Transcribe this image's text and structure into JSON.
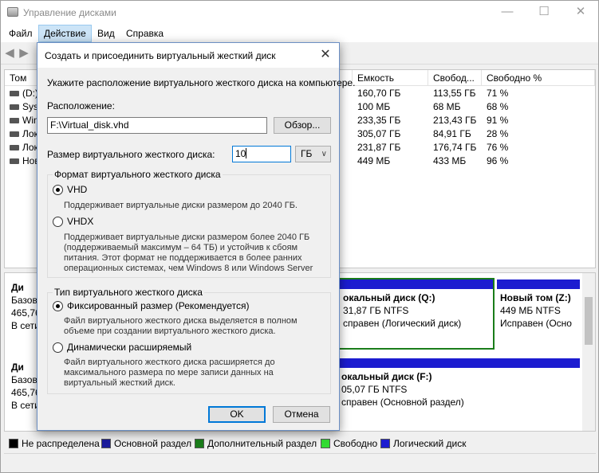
{
  "window": {
    "title": "Управление дисками",
    "controls": {
      "minimize": "—",
      "maximize": "☐",
      "close": "✕"
    }
  },
  "menu": [
    "Файл",
    "Действие",
    "Вид",
    "Справка"
  ],
  "volumes": {
    "columns": [
      "Том",
      "Емкость",
      "Свобод...",
      "Свободно %"
    ],
    "rows": [
      {
        "name": "(D:)",
        "capacity": "160,70 ГБ",
        "free": "113,55 ГБ",
        "free_pct": "71 %"
      },
      {
        "name": "Syst",
        "capacity": "100 МБ",
        "free": "68 МБ",
        "free_pct": "68 %"
      },
      {
        "name": "Win",
        "capacity": "233,35 ГБ",
        "free": "213,43 ГБ",
        "free_pct": "91 %"
      },
      {
        "name": "Лок",
        "capacity": "305,07 ГБ",
        "free": "84,91 ГБ",
        "free_pct": "28 %"
      },
      {
        "name": "Лок",
        "capacity": "231,87 ГБ",
        "free": "176,74 ГБ",
        "free_pct": "76 %"
      },
      {
        "name": "Нов",
        "capacity": "449 МБ",
        "free": "433 МБ",
        "free_pct": "96 %"
      }
    ]
  },
  "disks": [
    {
      "label": [
        "Ди",
        "Базов",
        "465,76",
        "В сети"
      ],
      "partitions": [
        {
          "lines": [
            "окальный диск  (Q:)",
            "31,87 ГБ NTFS",
            "справен (Логический диск)"
          ],
          "selected": true
        },
        {
          "lines": [
            "Новый том  (Z:)",
            "449 МБ NTFS",
            "Исправен (Осно"
          ],
          "selected": false
        }
      ]
    },
    {
      "label": [
        "Ди",
        "Базов",
        "465,76",
        "В сети"
      ],
      "partitions": [
        {
          "lines": [
            "окальный диск  (F:)",
            "05,07 ГБ NTFS",
            "справен (Основной раздел)"
          ],
          "selected": false
        }
      ]
    }
  ],
  "legend": [
    {
      "label": "Не распределена",
      "color": "#000000"
    },
    {
      "label": "Основной раздел",
      "color": "#1c1c9c"
    },
    {
      "label": "Дополнительный раздел",
      "color": "#1a7d1a"
    },
    {
      "label": "Свободно",
      "color": "#33dd33"
    },
    {
      "label": "Логический диск",
      "color": "#1c1cd0"
    }
  ],
  "dialog": {
    "title": "Создать и присоединить виртуальный жесткий диск",
    "close": "✕",
    "instruction": "Укажите расположение виртуального жесткого диска на компьютере.",
    "location_label": "Расположение:",
    "location_value": "F:\\Virtual_disk.vhd",
    "browse_button": "Обзор...",
    "size_label": "Размер виртуального жесткого диска:",
    "size_value": "10",
    "size_unit": "ГБ",
    "format_group": {
      "title": "Формат виртуального жесткого диска",
      "vhd_label": "VHD",
      "vhd_desc": "Поддерживает виртуальные диски размером до 2040 ГБ.",
      "vhdx_label": "VHDX",
      "vhdx_desc": [
        "Поддерживает виртуальные диски размером более 2040 ГБ",
        "(поддерживаемый максимум – 64 ТБ) и устойчив к сбоям",
        "питания. Этот формат не поддерживается в более ранних",
        "операционных системах, чем Windows 8 или Windows Server"
      ]
    },
    "type_group": {
      "title": "Тип виртуального жесткого диска",
      "fixed_label": "Фиксированный размер (Рекомендуется)",
      "fixed_desc": [
        "Файл виртуального жесткого диска выделяется в полном",
        "объеме при создании виртуального жесткого диска."
      ],
      "dynamic_label": "Динамически расширяемый",
      "dynamic_desc": [
        "Файл виртуального жесткого диска расширяется до",
        "максимального размера по мере записи данных на",
        "виртуальный жесткий диск."
      ]
    },
    "ok_button": "OK",
    "cancel_button": "Отмена"
  }
}
